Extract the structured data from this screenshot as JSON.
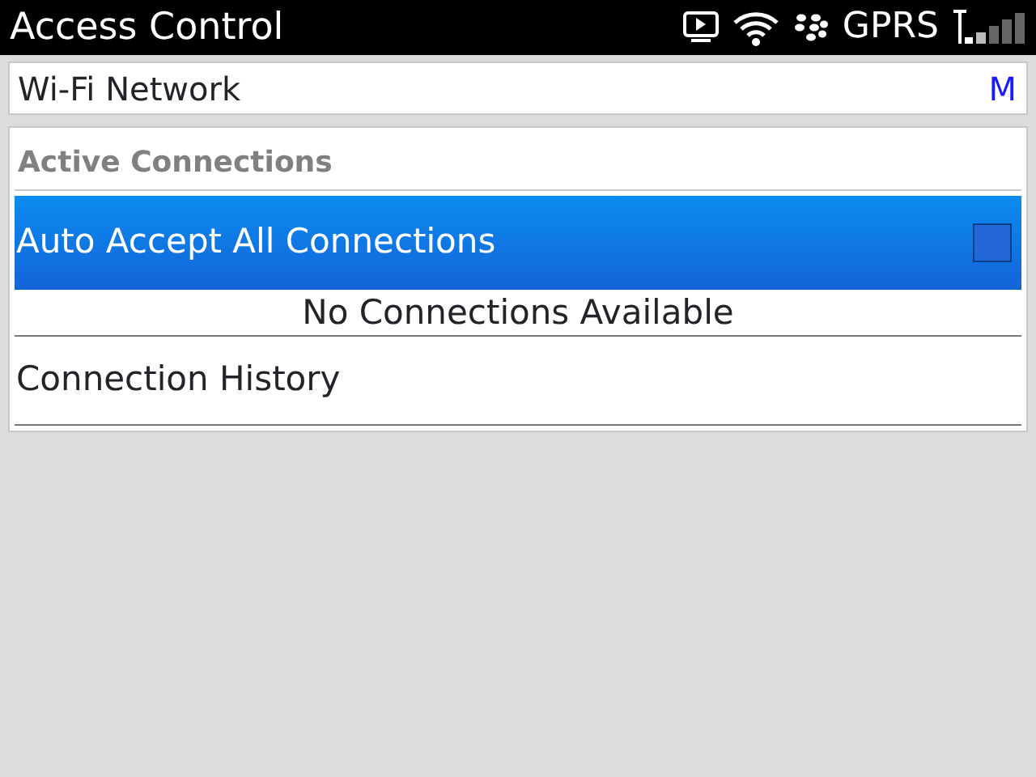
{
  "window": {
    "title": "Access Control"
  },
  "status_bar": {
    "network": "GPRS"
  },
  "wifi_row": {
    "label": "Wi-Fi Network",
    "value": "M"
  },
  "section": {
    "title": "Active Connections"
  },
  "options": [
    {
      "label": "Auto Accept All Connections",
      "selected": true,
      "checked": false
    }
  ],
  "empty_message": "No Connections Available",
  "menu_items": [
    {
      "label": "Connection History",
      "selected": false
    }
  ]
}
